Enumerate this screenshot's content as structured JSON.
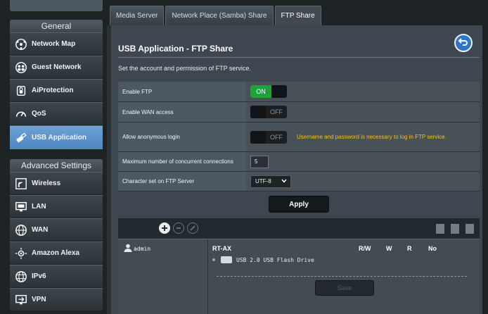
{
  "sidebar": {
    "top_stub": "",
    "general_title": "General",
    "advanced_title": "Advanced Settings",
    "general_items": [
      {
        "label": "Network Map",
        "icon": "network-map-icon"
      },
      {
        "label": "Guest Network",
        "icon": "guest-network-icon"
      },
      {
        "label": "AiProtection",
        "icon": "lock-icon"
      },
      {
        "label": "QoS",
        "icon": "gauge-icon"
      },
      {
        "label": "USB Application",
        "icon": "usb-icon",
        "active": true
      }
    ],
    "advanced_items": [
      {
        "label": "Wireless",
        "icon": "wireless-icon"
      },
      {
        "label": "LAN",
        "icon": "lan-icon"
      },
      {
        "label": "WAN",
        "icon": "globe-icon"
      },
      {
        "label": "Amazon Alexa",
        "icon": "alexa-icon"
      },
      {
        "label": "IPv6",
        "icon": "ipv6-icon"
      },
      {
        "label": "VPN",
        "icon": "vpn-icon"
      }
    ]
  },
  "tabs": [
    {
      "label": "Media Server"
    },
    {
      "label": "Network Place (Samba) Share"
    },
    {
      "label": "FTP Share",
      "active": true
    }
  ],
  "panel": {
    "title": "USB Application - FTP Share",
    "description": "Set the account and permission of FTP service."
  },
  "settings": {
    "enable_ftp": {
      "label": "Enable FTP",
      "state": "ON"
    },
    "enable_wan": {
      "label": "Enable WAN access",
      "state": "OFF"
    },
    "anonymous": {
      "label": "Allow anonymous login",
      "state": "OFF",
      "warning": "Username and password is necessary to log in FTP service."
    },
    "max_conn": {
      "label": "Maximum number of concurrent connections",
      "value": "5"
    },
    "charset": {
      "label": "Character set on FTP Server",
      "value": "UTF-8"
    }
  },
  "apply_label": "Apply",
  "accounts": {
    "users": [
      "admin"
    ],
    "device": "RT-AX",
    "columns": [
      "R/W",
      "W",
      "R",
      "No"
    ],
    "drive": "USB 2.0 USB Flash Drive",
    "save_label": "Save"
  },
  "colors": {
    "accent": "#4f86c0",
    "toggle_on": "#1ea33a",
    "warning": "#f5c217"
  }
}
